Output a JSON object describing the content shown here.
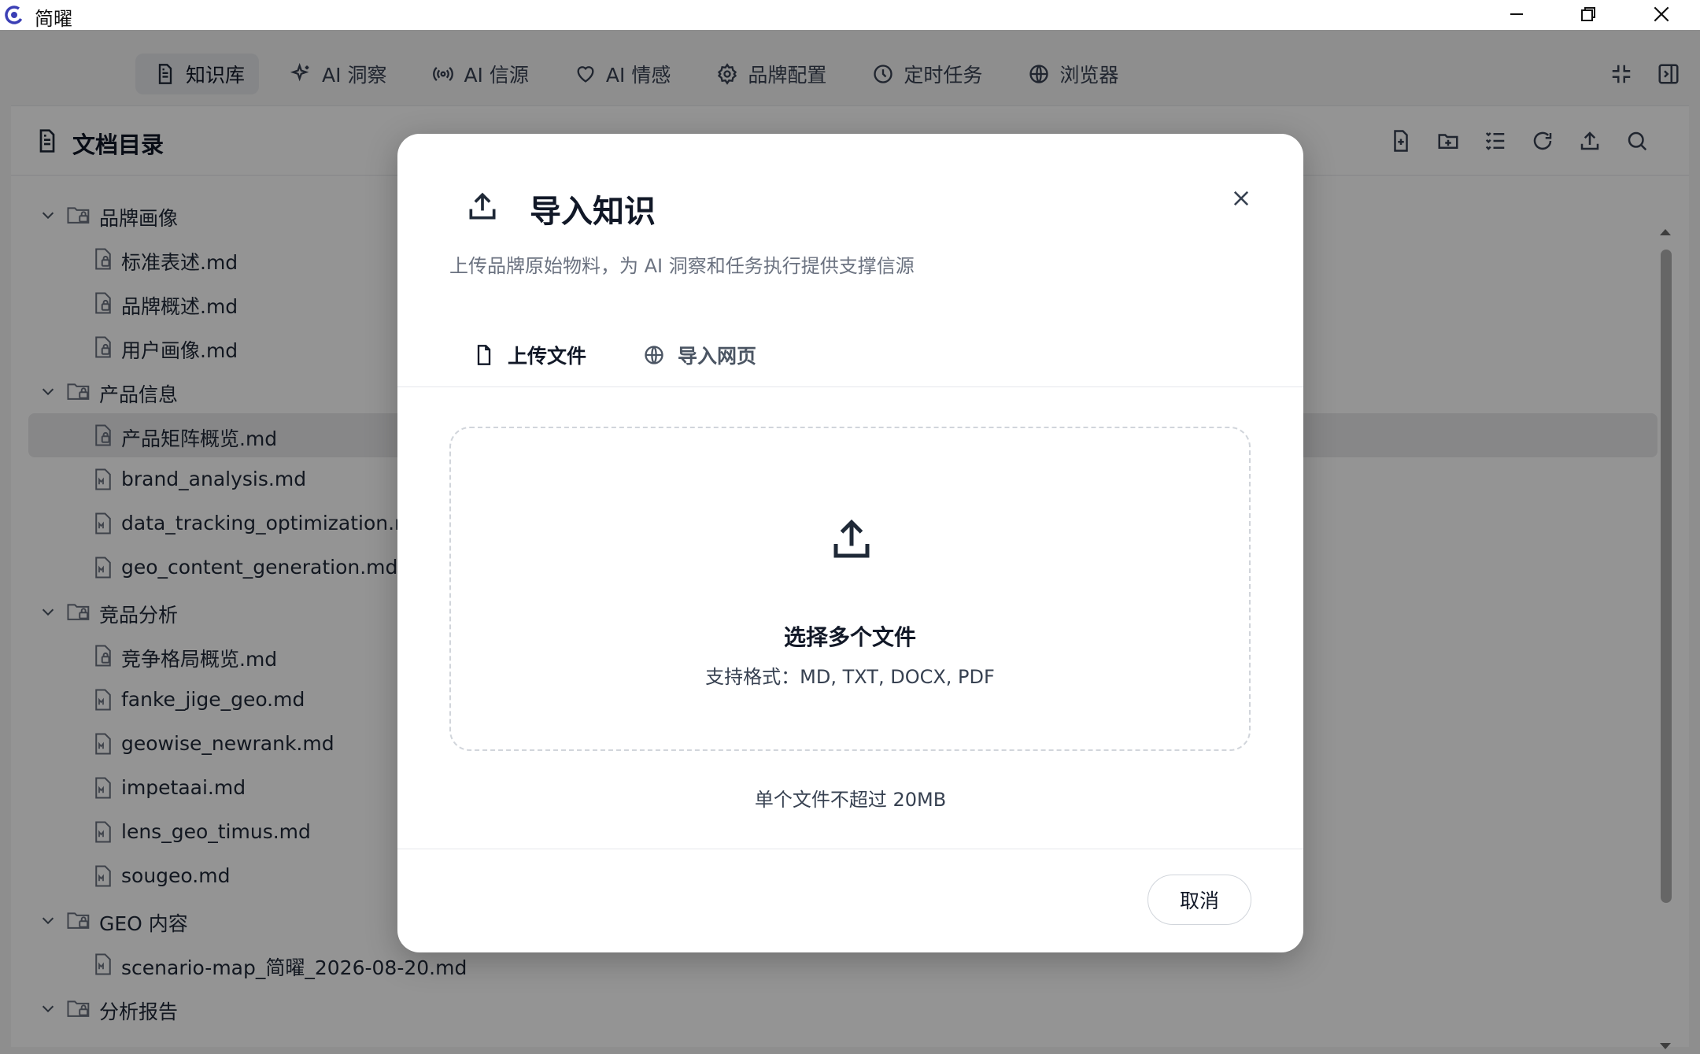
{
  "window": {
    "title": "简曜",
    "controls": [
      "minimize",
      "restore",
      "close"
    ]
  },
  "nav": {
    "tabs": [
      {
        "label": "知识库",
        "icon": "document-icon",
        "active": true
      },
      {
        "label": "AI 洞察",
        "icon": "sparkle-icon",
        "active": false
      },
      {
        "label": "AI 信源",
        "icon": "broadcast-icon",
        "active": false
      },
      {
        "label": "AI 情感",
        "icon": "heart-icon",
        "active": false
      },
      {
        "label": "品牌配置",
        "icon": "gear-icon",
        "active": false
      },
      {
        "label": "定时任务",
        "icon": "clock-icon",
        "active": false
      },
      {
        "label": "浏览器",
        "icon": "globe-icon",
        "active": false
      }
    ],
    "right_icons": [
      "collapse-icon",
      "sidebar-toggle-icon"
    ]
  },
  "directory": {
    "title": "文档目录",
    "toolbar": [
      "new-file-icon",
      "new-folder-icon",
      "list-icon",
      "refresh-icon",
      "upload-icon",
      "search-icon"
    ],
    "tree": [
      {
        "type": "folder",
        "label": "品牌画像"
      },
      {
        "type": "file",
        "label": "标准表述.md",
        "kind": "locked"
      },
      {
        "type": "file",
        "label": "品牌概述.md",
        "kind": "locked"
      },
      {
        "type": "file",
        "label": "用户画像.md",
        "kind": "locked"
      },
      {
        "type": "folder",
        "label": "产品信息"
      },
      {
        "type": "file",
        "label": "产品矩阵概览.md",
        "kind": "locked",
        "selected": true
      },
      {
        "type": "file",
        "label": "brand_analysis.md",
        "kind": "markdown"
      },
      {
        "type": "file",
        "label": "data_tracking_optimization.md",
        "kind": "markdown"
      },
      {
        "type": "file",
        "label": "geo_content_generation.md",
        "kind": "markdown"
      },
      {
        "type": "folder",
        "label": "竞品分析"
      },
      {
        "type": "file",
        "label": "竞争格局概览.md",
        "kind": "locked"
      },
      {
        "type": "file",
        "label": "fanke_jige_geo.md",
        "kind": "markdown"
      },
      {
        "type": "file",
        "label": "geowise_newrank.md",
        "kind": "markdown"
      },
      {
        "type": "file",
        "label": "impetaai.md",
        "kind": "markdown"
      },
      {
        "type": "file",
        "label": "lens_geo_timus.md",
        "kind": "markdown"
      },
      {
        "type": "file",
        "label": "sougeo.md",
        "kind": "markdown"
      },
      {
        "type": "folder",
        "label": "GEO 内容"
      },
      {
        "type": "file",
        "label": "scenario-map_简曜_2026-08-20.md",
        "kind": "markdown"
      },
      {
        "type": "folder",
        "label": "分析报告"
      }
    ]
  },
  "modal": {
    "title": "导入知识",
    "description": "上传品牌原始物料，为 AI 洞察和任务执行提供支撑信源",
    "tabs": [
      {
        "label": "上传文件",
        "icon": "file-icon",
        "active": true
      },
      {
        "label": "导入网页",
        "icon": "globe-icon",
        "active": false
      }
    ],
    "dropzone": {
      "title": "选择多个文件",
      "formats": "支持格式：MD, TXT, DOCX, PDF"
    },
    "size_note": "单个文件不超过 20MB",
    "cancel_label": "取消"
  },
  "colors": {
    "overlay": "#000000",
    "brand": "#3b3fb5",
    "selected_row": "#e8e8ea"
  }
}
